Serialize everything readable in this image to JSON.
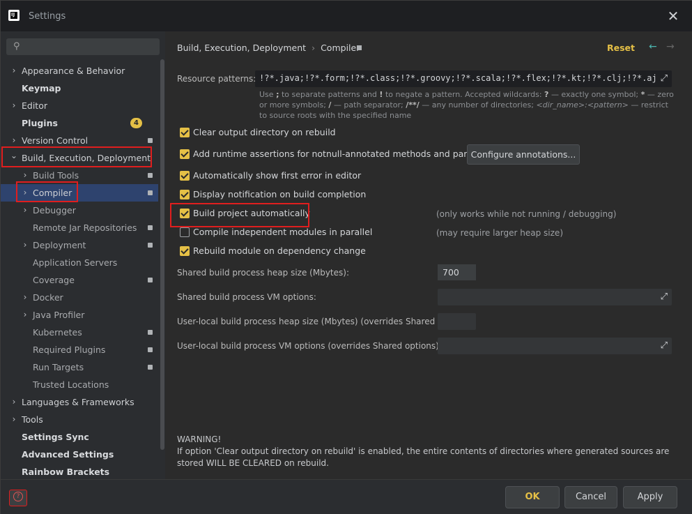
{
  "window": {
    "title": "Settings",
    "logo_text": "IJ"
  },
  "sidebar": {
    "search": {
      "placeholder": ""
    },
    "badge_plugins": "4",
    "items": [
      {
        "label": "Appearance & Behavior",
        "chev": "›"
      },
      {
        "label": "Keymap",
        "chev": ""
      },
      {
        "label": "Editor",
        "chev": "›"
      },
      {
        "label": "Plugins",
        "chev": ""
      },
      {
        "label": "Version Control",
        "chev": "›"
      },
      {
        "label": "Build, Execution, Deployment",
        "chev": "⌄"
      },
      {
        "label": "Build Tools",
        "chev": "›"
      },
      {
        "label": "Compiler",
        "chev": "›"
      },
      {
        "label": "Debugger",
        "chev": "›"
      },
      {
        "label": "Remote Jar Repositories",
        "chev": ""
      },
      {
        "label": "Deployment",
        "chev": "›"
      },
      {
        "label": "Application Servers",
        "chev": ""
      },
      {
        "label": "Coverage",
        "chev": ""
      },
      {
        "label": "Docker",
        "chev": "›"
      },
      {
        "label": "Java Profiler",
        "chev": "›"
      },
      {
        "label": "Kubernetes",
        "chev": ""
      },
      {
        "label": "Required Plugins",
        "chev": ""
      },
      {
        "label": "Run Targets",
        "chev": ""
      },
      {
        "label": "Trusted Locations",
        "chev": ""
      },
      {
        "label": "Languages & Frameworks",
        "chev": "›"
      },
      {
        "label": "Tools",
        "chev": "›"
      },
      {
        "label": "Settings Sync",
        "chev": ""
      },
      {
        "label": "Advanced Settings",
        "chev": ""
      },
      {
        "label": "Rainbow Brackets",
        "chev": ""
      }
    ]
  },
  "header": {
    "breadcrumb_1": "Build, Execution, Deployment",
    "breadcrumb_sep": "›",
    "breadcrumb_2": "Compiler",
    "reset": "Reset",
    "back_arrow": "←",
    "forward_arrow": "→"
  },
  "compiler": {
    "resource_patterns_label": "Resource patterns:",
    "resource_patterns_value": "!?*.java;!?*.form;!?*.class;!?*.groovy;!?*.scala;!?*.flex;!?*.kt;!?*.clj;!?*.aj",
    "hint_1": "Use",
    "hint_2": ";",
    "hint_3": "to separate patterns and",
    "hint_4": "!",
    "hint_5": "to negate a pattern. Accepted wildcards:",
    "hint_6": "?",
    "hint_7": "— exactly one symbol;",
    "hint_8": "*",
    "hint_9": "— zero or more symbols;",
    "hint_10": "/",
    "hint_11": "— path separator;",
    "hint_12": "/**/",
    "hint_13": "— any number of directories;",
    "hint_14": "<dir_name>:<pattern>",
    "hint_15": "— restrict to source roots with the specified name",
    "checkboxes": [
      {
        "label": "Clear output directory on rebuild",
        "checked": true
      },
      {
        "label": "Add runtime assertions for notnull-annotated methods and parameters",
        "checked": true
      },
      {
        "label": "Automatically show first error in editor",
        "checked": true
      },
      {
        "label": "Display notification on build completion",
        "checked": true
      },
      {
        "label": "Build project automatically",
        "checked": true
      },
      {
        "label": "Compile independent modules in parallel",
        "checked": false
      },
      {
        "label": "Rebuild module on dependency change",
        "checked": true
      }
    ],
    "configure_annotations": "Configure annotations...",
    "note_build_auto": "(only works while not running / debugging)",
    "note_parallel": "(may require larger heap size)",
    "heap_label": "Shared build process heap size (Mbytes):",
    "heap_value": "700",
    "vm_label": "Shared build process VM options:",
    "user_heap_label": "User-local build process heap size (Mbytes) (overrides Shared size):",
    "user_vm_label": "User-local build process VM options (overrides Shared options):",
    "warning_title": "WARNING!",
    "warning_text": "If option 'Clear output directory on rebuild' is enabled, the entire contents of directories where generated sources are stored WILL BE CLEARED on rebuild."
  },
  "footer": {
    "ok": "OK",
    "cancel": "Cancel",
    "apply": "Apply",
    "help_glyph": "?"
  },
  "colors": {
    "accent": "#e5c046",
    "highlight_box": "#e01e1e",
    "selection": "#2e436e"
  }
}
